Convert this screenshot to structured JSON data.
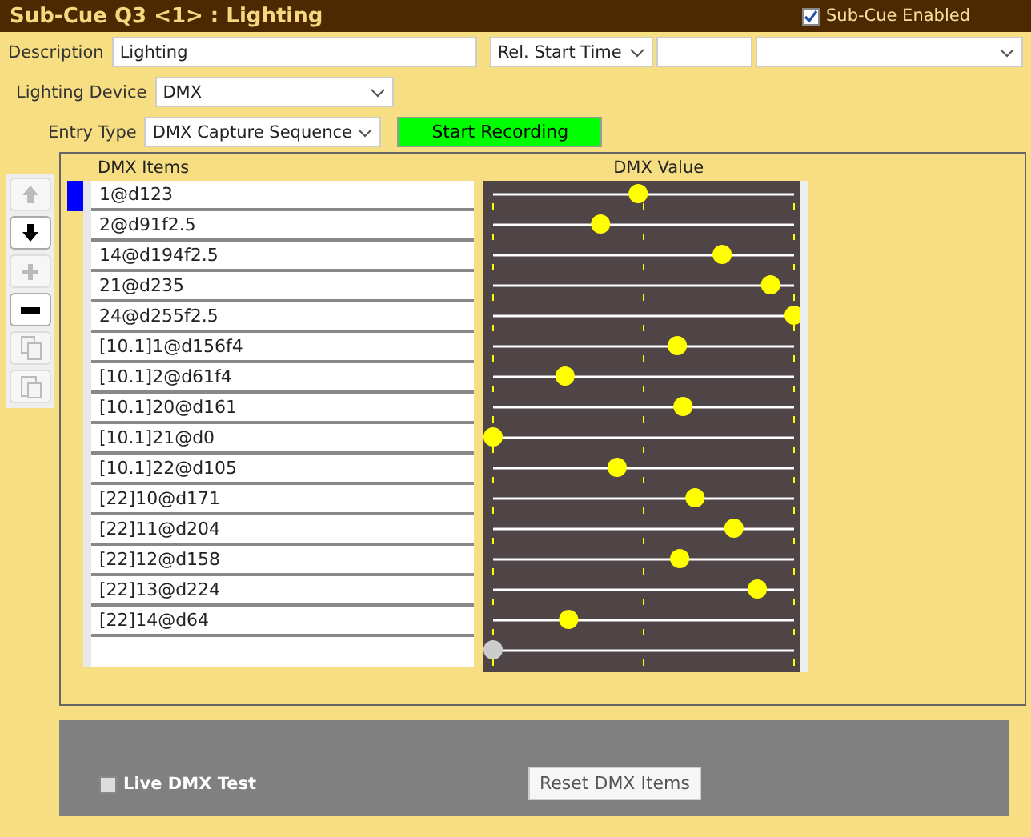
{
  "header": {
    "title": "Sub-Cue Q3 <1> : Lighting",
    "enabled_checkbox": {
      "label": "Sub-Cue Enabled",
      "checked": true
    }
  },
  "description": {
    "label": "Description",
    "value": "Lighting"
  },
  "start_time": {
    "mode": "Rel. Start Time"
  },
  "lighting_device": {
    "label": "Lighting Device",
    "value": "DMX"
  },
  "entry_type": {
    "label": "Entry Type",
    "value": "DMX Capture Sequence"
  },
  "record_button": "Start Recording",
  "toolbar": [
    {
      "kind": "up",
      "disabled": true
    },
    {
      "kind": "down",
      "disabled": false
    },
    {
      "kind": "add",
      "disabled": true
    },
    {
      "kind": "remove",
      "disabled": false
    },
    {
      "kind": "copy",
      "disabled": true
    },
    {
      "kind": "paste",
      "disabled": true
    }
  ],
  "columns": [
    "DMX Items",
    "DMX Value"
  ],
  "items": [
    {
      "text": "1@d123",
      "level": 0.482,
      "selected": true
    },
    {
      "text": "2@d91f2.5",
      "level": 0.357,
      "selected": false
    },
    {
      "text": "14@d194f2.5",
      "level": 0.761,
      "selected": false
    },
    {
      "text": "21@d235",
      "level": 0.922,
      "selected": false
    },
    {
      "text": "24@d255f2.5",
      "level": 1,
      "selected": false
    },
    {
      "text": "[10.1]1@d156f4",
      "level": 0.612,
      "selected": false
    },
    {
      "text": "[10.1]2@d61f4",
      "level": 0.239,
      "selected": false
    },
    {
      "text": "[10.1]20@d161",
      "level": 0.631,
      "selected": false
    },
    {
      "text": "[10.1]21@d0",
      "level": 0,
      "selected": false
    },
    {
      "text": "[10.1]22@d105",
      "level": 0.412,
      "selected": false
    },
    {
      "text": "[22]10@d171",
      "level": 0.671,
      "selected": false
    },
    {
      "text": "[22]11@d204",
      "level": 0.8,
      "selected": false
    },
    {
      "text": "[22]12@d158",
      "level": 0.62,
      "selected": false
    },
    {
      "text": "[22]13@d224",
      "level": 0.878,
      "selected": false
    },
    {
      "text": "[22]14@d64",
      "level": 0.251,
      "selected": false
    }
  ],
  "new_item_slider": {
    "level": 0
  },
  "live_test": {
    "label": "Live DMX Test",
    "checked": false
  },
  "reset_button": "Reset DMX Items"
}
